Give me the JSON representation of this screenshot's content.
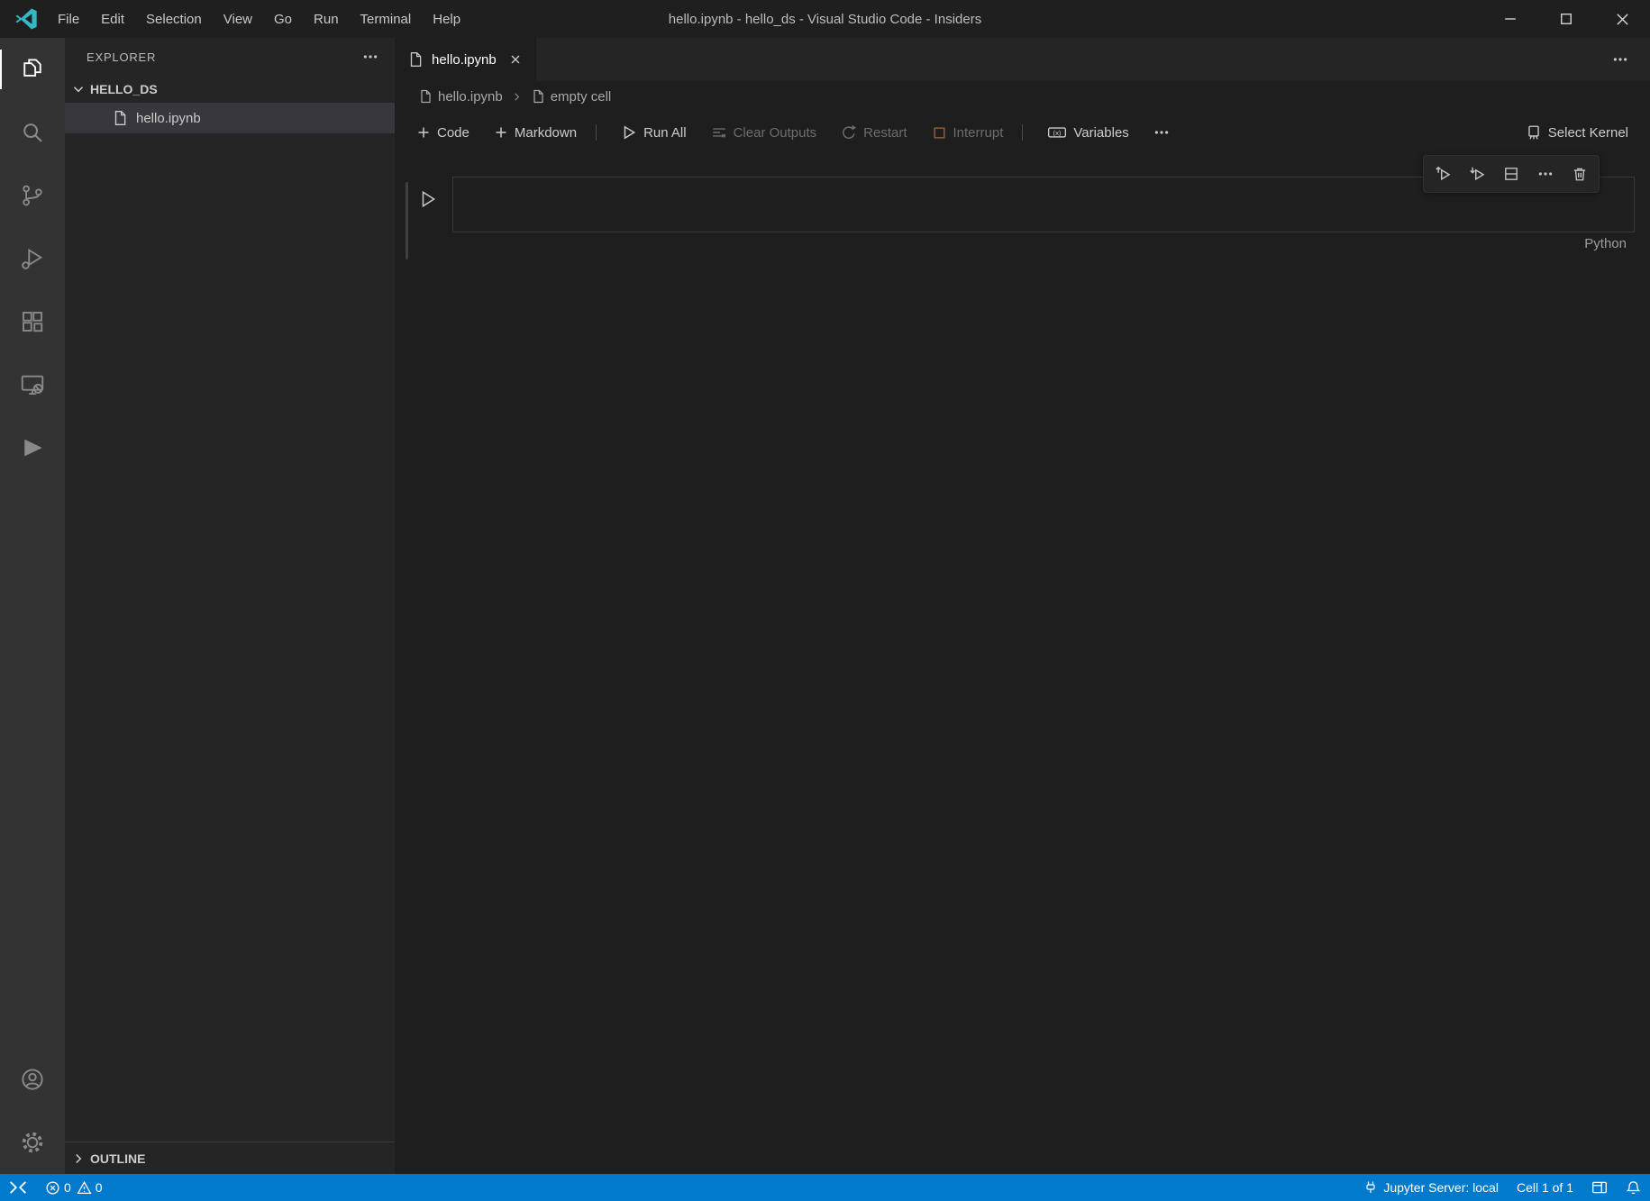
{
  "colors": {
    "statusbar_background": "#007acc",
    "insiders_logo_teal": "#35b8c6",
    "list_selection_background": "#37373d",
    "interrupt_icon_orange": "#9c5f2e"
  },
  "window": {
    "title": "hello.ipynb - hello_ds - Visual Studio Code - Insiders"
  },
  "menu_bar": {
    "items": [
      "File",
      "Edit",
      "Selection",
      "View",
      "Go",
      "Run",
      "Terminal",
      "Help"
    ]
  },
  "activity_bar": {
    "items": [
      "explorer",
      "search",
      "source-control",
      "run-and-debug",
      "extensions",
      "remote-explorer",
      "filled-play",
      "accounts",
      "settings"
    ]
  },
  "explorer": {
    "header": "EXPLORER",
    "workspace": "HELLO_DS",
    "files": [
      {
        "name": "hello.ipynb",
        "selected": true
      }
    ],
    "outline_header": "OUTLINE"
  },
  "editor": {
    "tabs": [
      {
        "label": "hello.ipynb",
        "active": true
      }
    ],
    "breadcrumbs": {
      "file": "hello.ipynb",
      "cell": "empty cell"
    }
  },
  "notebook_toolbar": {
    "code": "Code",
    "markdown": "Markdown",
    "run_all": "Run All",
    "clear_outputs": "Clear Outputs",
    "restart": "Restart",
    "interrupt": "Interrupt",
    "variables": "Variables",
    "select_kernel": "Select Kernel"
  },
  "cell": {
    "content": "",
    "language": "Python"
  },
  "status_bar": {
    "errors": "0",
    "warnings": "0",
    "jupyter_server": "Jupyter Server: local",
    "cell_position": "Cell 1 of 1"
  }
}
